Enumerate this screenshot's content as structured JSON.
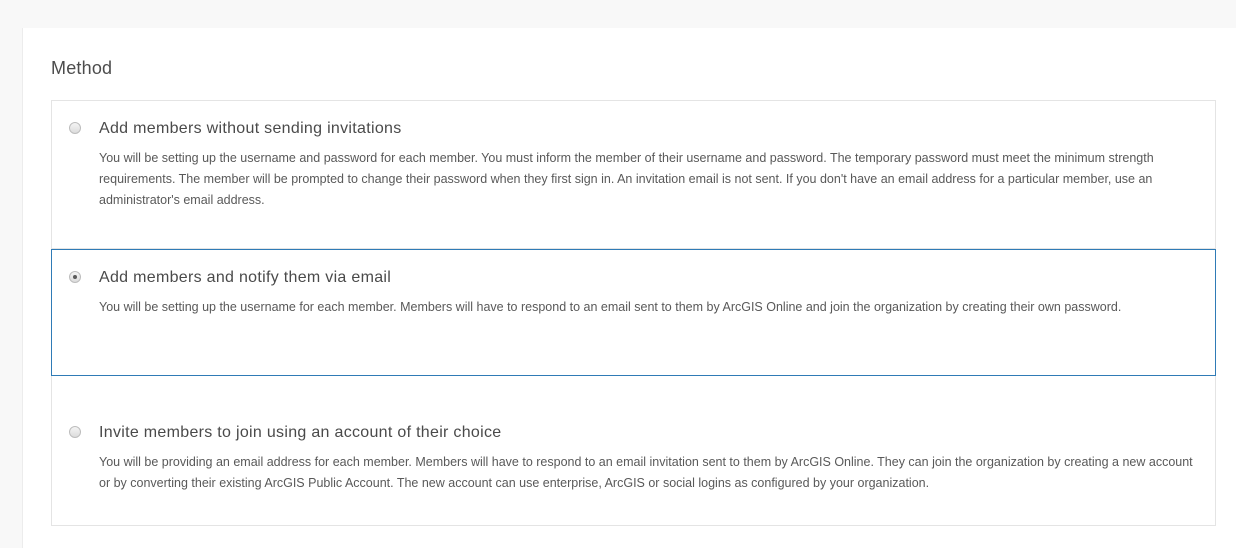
{
  "method": {
    "title": "Method",
    "options": [
      {
        "label": "Add members without sending invitations",
        "description": "You will be setting up the username and password for each member. You must inform the member of their username and password. The temporary password must meet the minimum strength requirements. The member will be prompted to change their password when they first sign in. An invitation email is not sent. If you don't have an email address for a particular member, use an administrator's email address.",
        "selected": false
      },
      {
        "label": "Add members and notify them via email",
        "description": "You will be setting up the username for each member. Members will have to respond to an email sent to them by ArcGIS Online and join the organization by creating their own password.",
        "selected": true
      },
      {
        "label": "Invite members to join using an account of their choice",
        "description": "You will be providing an email address for each member. Members will have to respond to an email invitation sent to them by ArcGIS Online. They can join the organization by creating a new account or by converting their existing ArcGIS Public Account. The new account can use enterprise, ArcGIS or social logins as configured by your organization.",
        "selected": false
      }
    ]
  },
  "colors": {
    "selected_border": "#2f7bb6",
    "option_border": "#e4e4e4",
    "page_background": "#f8f8f8"
  }
}
